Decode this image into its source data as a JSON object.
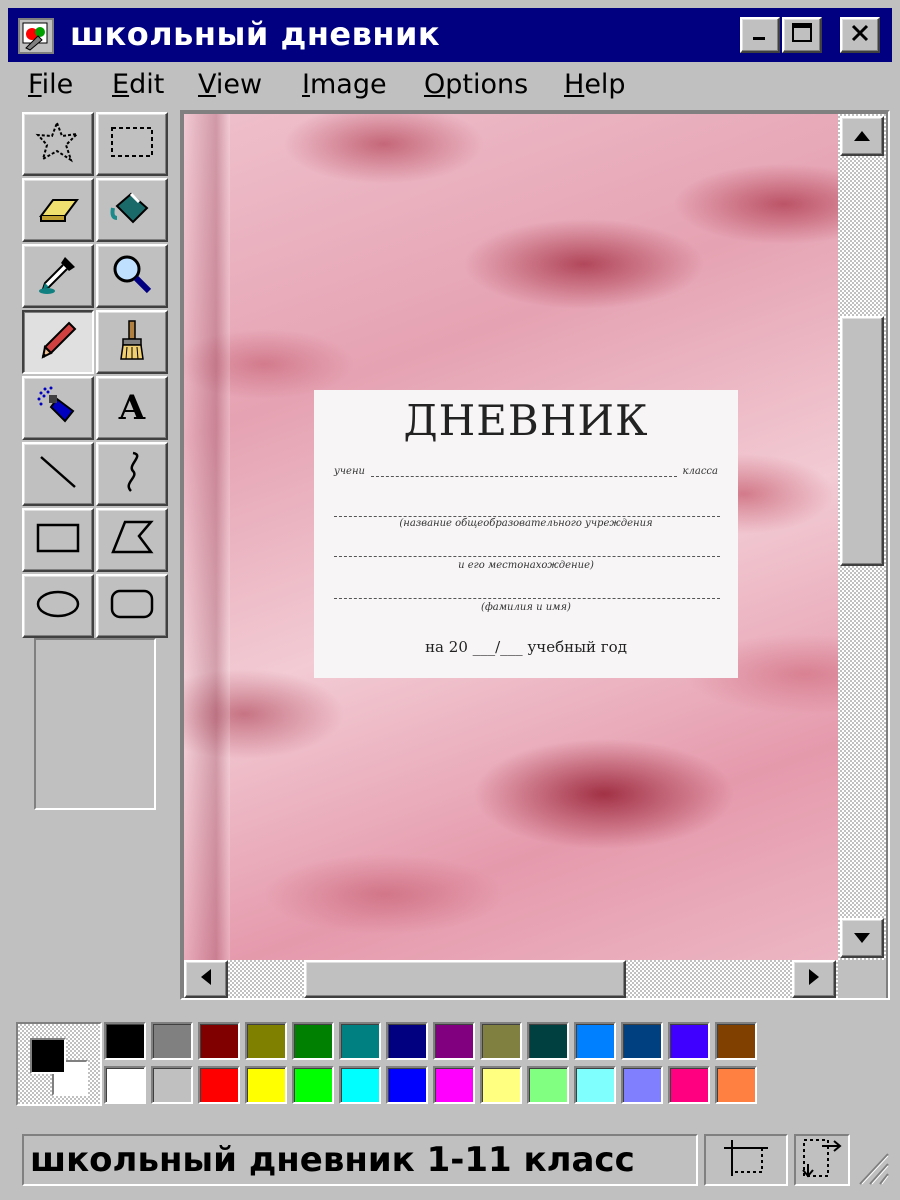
{
  "window": {
    "title": "школьный дневник",
    "minimize_icon": "minimize-icon",
    "maximize_icon": "maximize-icon",
    "close_icon": "close-icon"
  },
  "menu": [
    "File",
    "Edit",
    "View",
    "Image",
    "Options",
    "Help"
  ],
  "tools": [
    "free-form-select-icon",
    "select-icon",
    "eraser-icon",
    "fill-bucket-icon",
    "color-picker-icon",
    "magnifier-icon",
    "pencil-icon",
    "brush-icon",
    "airbrush-icon",
    "text-icon",
    "line-icon",
    "curve-icon",
    "rectangle-icon",
    "polygon-icon",
    "ellipse-icon",
    "rounded-rectangle-icon"
  ],
  "selected_tool": "pencil-icon",
  "canvas": {
    "title": "ДНЕВНИК",
    "student_prefix": "учени",
    "student_suffix": "класса",
    "caption_institution": "(название общеобразовательного учреждения",
    "caption_location": "и его местонахождение)",
    "caption_name": "(фамилия и имя)",
    "year_text": "на 20 ___/___ учебный год"
  },
  "palette": {
    "foreground": "#000000",
    "background": "#ffffff",
    "row1": [
      "#000000",
      "#808080",
      "#800000",
      "#808000",
      "#008000",
      "#008080",
      "#000080",
      "#800080",
      "#808040",
      "#004040",
      "#0080ff",
      "#004080",
      "#4000ff",
      "#804000"
    ],
    "row2": [
      "#ffffff",
      "#c0c0c0",
      "#ff0000",
      "#ffff00",
      "#00ff00",
      "#00ffff",
      "#0000ff",
      "#ff00ff",
      "#ffff80",
      "#80ff80",
      "#80ffff",
      "#8080ff",
      "#ff0080",
      "#ff8040"
    ]
  },
  "status": {
    "text": "школьный дневник 1-11 класс",
    "position_icon": "cursor-position-icon",
    "size_icon": "selection-size-icon"
  }
}
